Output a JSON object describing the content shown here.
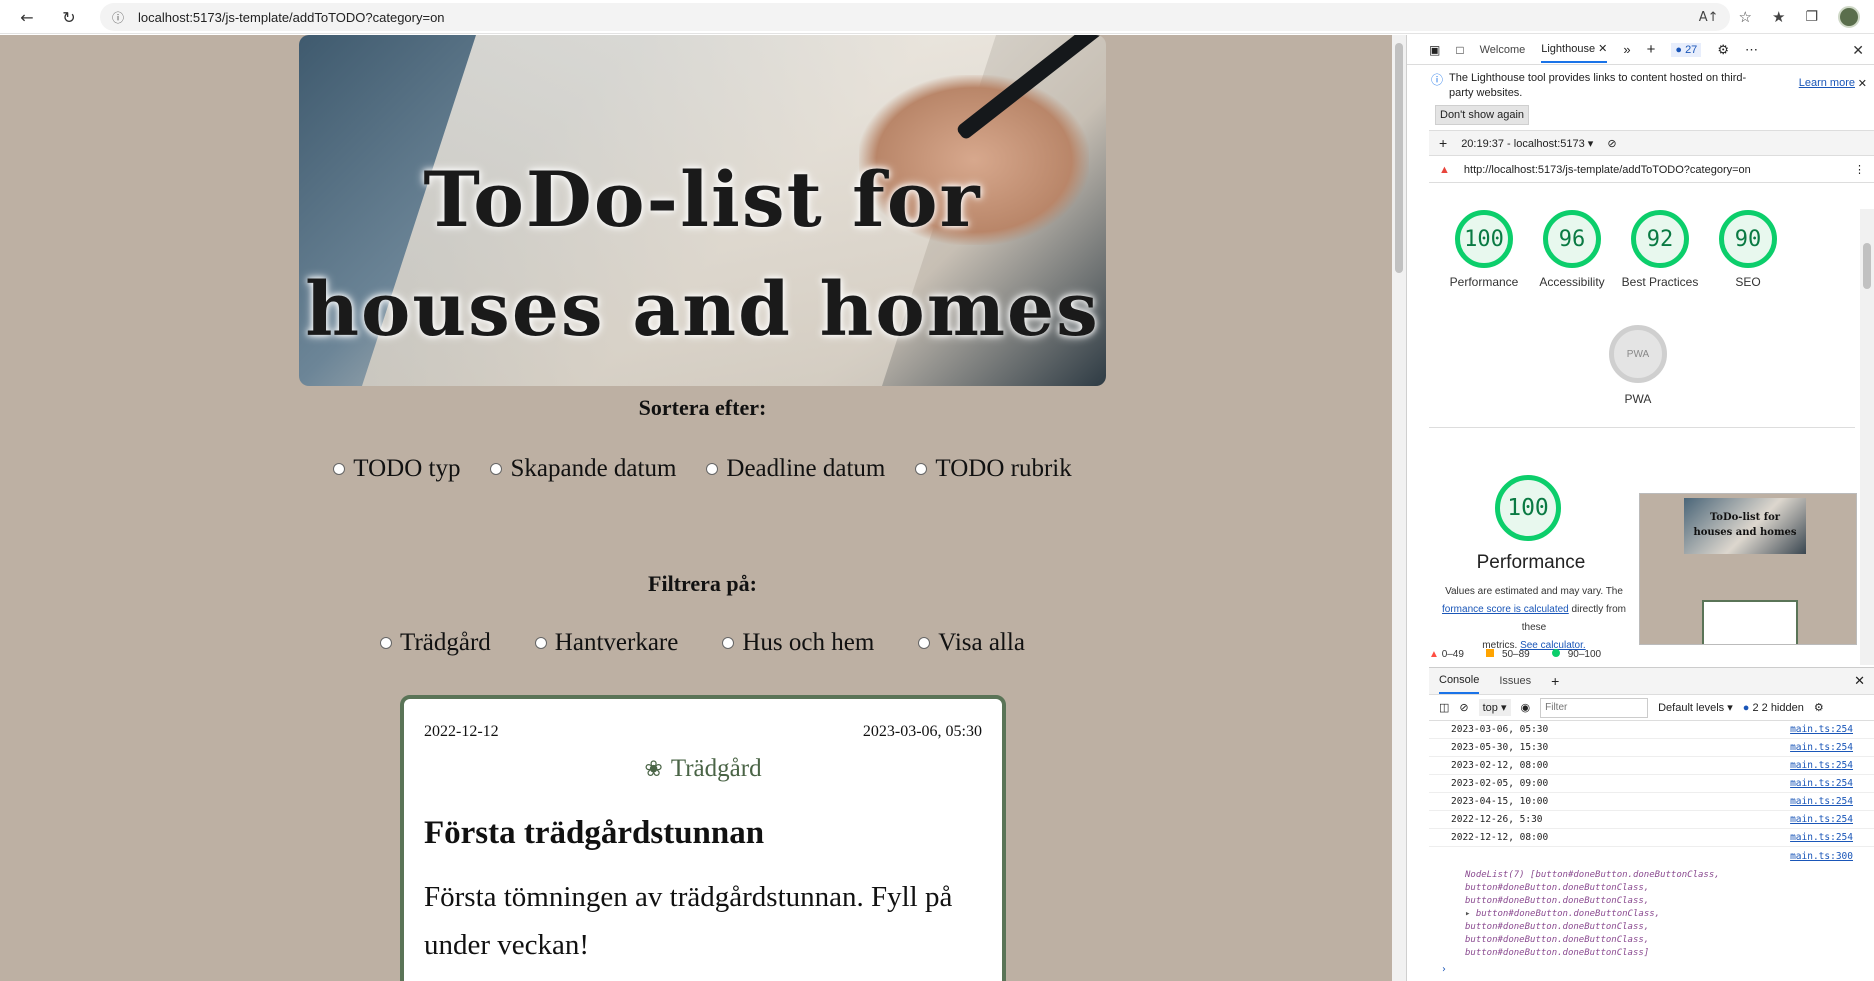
{
  "browser": {
    "url": "localhost:5173/js-template/addToTODO?category=on",
    "url_host": "localhost",
    "url_rest": ":5173/js-template/addToTODO?category=on"
  },
  "page": {
    "hero": {
      "line1": "ToDo-list for",
      "line2": "houses and homes"
    },
    "sort": {
      "label": "Sortera efter:",
      "options": [
        "TODO typ",
        "Skapande datum",
        "Deadline datum",
        "TODO rubrik"
      ]
    },
    "filter": {
      "label": "Filtrera på:",
      "options": [
        "Trädgård",
        "Hantverkare",
        "Hus och hem",
        "Visa alla"
      ]
    },
    "card": {
      "created": "2022-12-12",
      "deadline": "2023-03-06, 05:30",
      "category": "Trädgård",
      "title": "Första trädgårdstunnan",
      "description": "Första tömningen av trädgårdstunnan. Fyll på under veckan!"
    }
  },
  "devtools": {
    "tabs": [
      "Welcome",
      "Lighthouse"
    ],
    "issues_count": "27",
    "info": {
      "text": "The Lighthouse tool provides links to content hosted on third-party websites.",
      "learn_more": "Learn more",
      "dont_show": "Don't show again"
    },
    "report_time": "20:19:37 - localhost:5173",
    "report_url": "http://localhost:5173/js-template/addToTODO?category=on",
    "scores": [
      {
        "value": "100",
        "label": "Performance"
      },
      {
        "value": "96",
        "label": "Accessibility"
      },
      {
        "value": "92",
        "label": "Best Practices"
      },
      {
        "value": "90",
        "label": "SEO"
      }
    ],
    "pwa": {
      "badge": "PWA",
      "label": "PWA"
    },
    "performance": {
      "score": "100",
      "title": "Performance",
      "note_1": "Values are estimated and may vary. The",
      "note_link": "formance score is calculated",
      "note_2": "directly from these",
      "note_3": "metrics.",
      "calc_link": "See calculator."
    },
    "thumb": {
      "line1": "ToDo-list for",
      "line2": "houses and homes"
    },
    "legend": [
      "0–49",
      "50–89",
      "90–100"
    ],
    "console": {
      "tabs": [
        "Console",
        "Issues"
      ],
      "context": "top",
      "filter_placeholder": "Filter",
      "levels": "Default levels",
      "hidden": "2 hidden",
      "hidden_count": "2",
      "logs": [
        {
          "text": "2023-03-06, 05:30",
          "src": "main.ts:254"
        },
        {
          "text": "2023-05-30, 15:30",
          "src": "main.ts:254"
        },
        {
          "text": "2023-02-12, 08:00",
          "src": "main.ts:254"
        },
        {
          "text": "2023-02-05, 09:00",
          "src": "main.ts:254"
        },
        {
          "text": "2023-04-15, 10:00",
          "src": "main.ts:254"
        },
        {
          "text": "2022-12-26, 5:30",
          "src": "main.ts:254"
        },
        {
          "text": "2022-12-12, 08:00",
          "src": "main.ts:254"
        }
      ],
      "nodelist_src": "main.ts:300",
      "nodelist_head": "NodeList(7) [button#doneButton.doneButtonClass,",
      "nodelist_line": "button#doneButton.doneButtonClass,",
      "nodelist_tail": "button#doneButton.doneButtonClass]"
    }
  }
}
